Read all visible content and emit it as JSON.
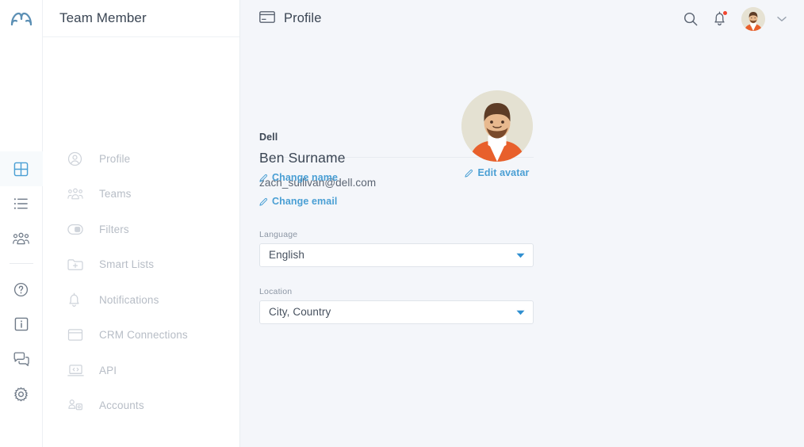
{
  "brand": {
    "logo_name": "app-logo",
    "logo_color": "#5b8fb4"
  },
  "colors": {
    "accent_link": "#4a9fd4",
    "active_nav": "#4a9fd4",
    "notification_dot": "#f0452f",
    "main_bg": "#f4f6fa",
    "text_primary": "#3b4654",
    "text_muted": "#b7bdc6",
    "avatar_bg": "#e4e1d2",
    "avatar_shirt": "#e8602c"
  },
  "rail": {
    "items": [
      {
        "name": "dashboard",
        "icon": "grid-icon",
        "active": true
      },
      {
        "name": "lists",
        "icon": "list-icon",
        "active": false
      },
      {
        "name": "teams",
        "icon": "people-icon",
        "active": false
      },
      {
        "name": "help",
        "icon": "question-circle-icon",
        "active": false
      },
      {
        "name": "info",
        "icon": "info-square-icon",
        "active": false
      },
      {
        "name": "messages",
        "icon": "chat-bubbles-icon",
        "active": false
      },
      {
        "name": "settings",
        "icon": "gear-icon",
        "active": false
      }
    ]
  },
  "sidebar": {
    "title": "Team Member",
    "items": [
      {
        "label": "Profile",
        "icon": "user-circle-icon"
      },
      {
        "label": "Teams",
        "icon": "people-icon"
      },
      {
        "label": "Filters",
        "icon": "toggle-icon"
      },
      {
        "label": "Smart Lists",
        "icon": "folder-plus-icon"
      },
      {
        "label": "Notifications",
        "icon": "bell-icon"
      },
      {
        "label": "CRM Connections",
        "icon": "browser-window-icon"
      },
      {
        "label": "API",
        "icon": "laptop-code-icon"
      },
      {
        "label": "Accounts",
        "icon": "accounts-icon"
      }
    ]
  },
  "topbar": {
    "icon": "id-card-icon",
    "title": "Profile",
    "search_icon": "search-icon",
    "bell_icon": "bell-icon",
    "has_notification": true,
    "avatar_icon": "user-avatar",
    "chevron_icon": "chevron-down-icon"
  },
  "profile": {
    "organization": "Dell",
    "full_name": "Ben Surname",
    "change_name_label": "Change name",
    "change_name_icon": "pencil-icon",
    "avatar_icon": "user-avatar-large",
    "edit_avatar_label": "Edit avatar",
    "edit_avatar_icon": "pencil-icon",
    "email": "zach_sullivan@dell.com",
    "change_email_label": "Change email",
    "change_email_icon": "pencil-icon",
    "fields": [
      {
        "label": "Language",
        "value": "English",
        "caret_icon": "caret-down-icon",
        "options": [
          "English"
        ]
      },
      {
        "label": "Location",
        "value": "City, Country",
        "caret_icon": "caret-down-icon",
        "options": [
          "City, Country"
        ]
      }
    ]
  }
}
